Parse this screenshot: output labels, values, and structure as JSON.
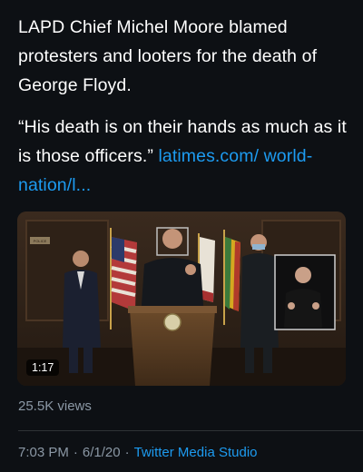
{
  "tweet": {
    "text_line1": "LAPD Chief Michel Moore blamed protesters and looters for the death of George Floyd.",
    "quote": "“His death is on their hands as much as it is those officers.” ",
    "link_text": "latimes.com/ world-nation/l..."
  },
  "video": {
    "duration": "1:17",
    "sign_text": "POLICE",
    "icon": "video-thumbnail"
  },
  "stats": {
    "views": "25.5K views"
  },
  "meta": {
    "time": "7:03 PM",
    "separator": "·",
    "date": "6/1/20",
    "source": "Twitter Media Studio"
  },
  "colors": {
    "background": "#0d1014",
    "link": "#1d9bf0",
    "muted": "#8b98a5"
  }
}
